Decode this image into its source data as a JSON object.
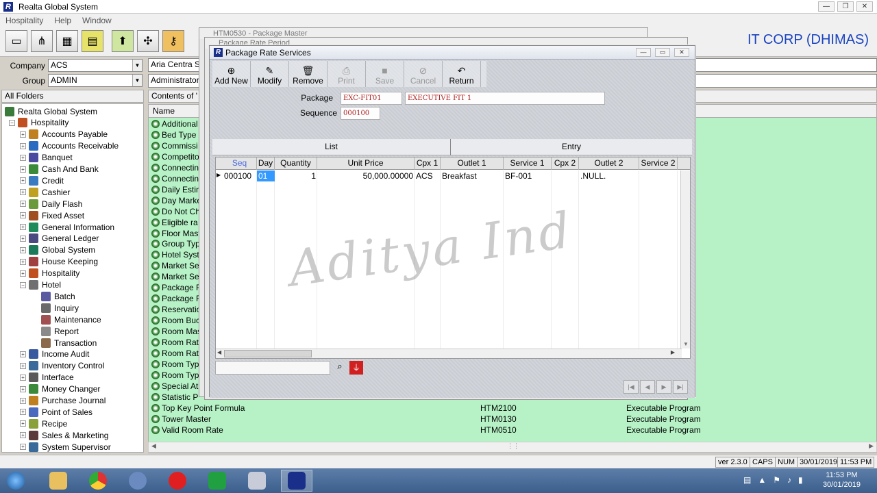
{
  "window": {
    "title": "Realta Global System",
    "logo": "R"
  },
  "menu": [
    "Hospitality",
    "Help",
    "Window"
  ],
  "corp": "IT CORP (DHIMAS)",
  "left": {
    "company_label": "Company",
    "company_value": "ACS",
    "group_label": "Group",
    "group_value": "ADMIN",
    "folders_header": "All Folders",
    "tree": [
      {
        "label": "Realta Global System",
        "level": 0,
        "exp": "",
        "color": "#3a7a3a"
      },
      {
        "label": "Hospitality",
        "level": 1,
        "exp": "−",
        "color": "#c05020"
      },
      {
        "label": "Accounts Payable",
        "level": 2,
        "exp": "+",
        "color": "#c08020"
      },
      {
        "label": "Accounts Receivable",
        "level": 2,
        "exp": "+",
        "color": "#2a6ac0"
      },
      {
        "label": "Banquet",
        "level": 2,
        "exp": "+",
        "color": "#4a4aa0"
      },
      {
        "label": "Cash And Bank",
        "level": 2,
        "exp": "+",
        "color": "#3a8a3a"
      },
      {
        "label": "Credit",
        "level": 2,
        "exp": "+",
        "color": "#3a7ac0"
      },
      {
        "label": "Cashier",
        "level": 2,
        "exp": "+",
        "color": "#c0a020"
      },
      {
        "label": "Daily Flash",
        "level": 2,
        "exp": "+",
        "color": "#6a9a3a"
      },
      {
        "label": "Fixed Asset",
        "level": 2,
        "exp": "+",
        "color": "#a05020"
      },
      {
        "label": "General Information",
        "level": 2,
        "exp": "+",
        "color": "#208a5a"
      },
      {
        "label": "General Ledger",
        "level": 2,
        "exp": "+",
        "color": "#4a4a80"
      },
      {
        "label": "Global System",
        "level": 2,
        "exp": "+",
        "color": "#1a7a5a"
      },
      {
        "label": "House Keeping",
        "level": 2,
        "exp": "+",
        "color": "#a04040"
      },
      {
        "label": "Hospitality",
        "level": 2,
        "exp": "+",
        "color": "#c05020"
      },
      {
        "label": "Hotel",
        "level": 2,
        "exp": "−",
        "color": "#707070"
      },
      {
        "label": "Batch",
        "level": 3,
        "exp": "",
        "color": "#5a5aa0"
      },
      {
        "label": "Inquiry",
        "level": 3,
        "exp": "",
        "color": "#6a6a6a"
      },
      {
        "label": "Maintenance",
        "level": 3,
        "exp": "",
        "color": "#a05050"
      },
      {
        "label": "Report",
        "level": 3,
        "exp": "",
        "color": "#8a8a8a"
      },
      {
        "label": "Transaction",
        "level": 3,
        "exp": "",
        "color": "#8a6a4a"
      },
      {
        "label": "Income Audit",
        "level": 2,
        "exp": "+",
        "color": "#3a5aa0"
      },
      {
        "label": "Inventory Control",
        "level": 2,
        "exp": "+",
        "color": "#3a6a9a"
      },
      {
        "label": "Interface",
        "level": 2,
        "exp": "+",
        "color": "#5a5a5a"
      },
      {
        "label": "Money Changer",
        "level": 2,
        "exp": "+",
        "color": "#3a8a3a"
      },
      {
        "label": "Purchase Journal",
        "level": 2,
        "exp": "+",
        "color": "#c08020"
      },
      {
        "label": "Point of Sales",
        "level": 2,
        "exp": "+",
        "color": "#4a6ac0"
      },
      {
        "label": "Recipe",
        "level": 2,
        "exp": "+",
        "color": "#8aa03a"
      },
      {
        "label": "Sales & Marketing",
        "level": 2,
        "exp": "+",
        "color": "#5a3a3a"
      },
      {
        "label": "System Supervisor",
        "level": 2,
        "exp": "+",
        "color": "#3a6a9a"
      }
    ]
  },
  "content": {
    "path1": "Aria Centra S",
    "path2": "Administrator",
    "contents_header": "Contents of '",
    "col_name": "Name",
    "items": [
      {
        "name": "Additional"
      },
      {
        "name": "Bed Type"
      },
      {
        "name": "Commissi"
      },
      {
        "name": "Competito"
      },
      {
        "name": "Connectin"
      },
      {
        "name": "Connectin"
      },
      {
        "name": "Daily Estin"
      },
      {
        "name": "Day Marke"
      },
      {
        "name": "Do Not Ch"
      },
      {
        "name": "Eligible ra"
      },
      {
        "name": "Floor Mast"
      },
      {
        "name": "Group Typ"
      },
      {
        "name": "Hotel Syst"
      },
      {
        "name": "Market Se"
      },
      {
        "name": "Market Se"
      },
      {
        "name": "Package F"
      },
      {
        "name": "Package F"
      },
      {
        "name": "Reservatio"
      },
      {
        "name": "Room Buc"
      },
      {
        "name": "Room Mas"
      },
      {
        "name": "Room Rat"
      },
      {
        "name": "Room Rat"
      },
      {
        "name": "Room Typ"
      },
      {
        "name": "Room Typ"
      },
      {
        "name": "Special At"
      },
      {
        "name": "Statistic P"
      }
    ],
    "full_items": [
      {
        "name": "Top Key Point Formula",
        "code": "HTM2100",
        "type": "Executable Program"
      },
      {
        "name": "Tower Master",
        "code": "HTM0130",
        "type": "Executable Program"
      },
      {
        "name": "Valid Room Rate",
        "code": "HTM0510",
        "type": "Executable Program"
      }
    ]
  },
  "bg_windows": {
    "w1": "HTM0530 - Package Master",
    "w2": "Package Rate Period"
  },
  "dialog": {
    "title": "Package Rate Services",
    "toolbar": [
      {
        "label": "Add New",
        "icon": "add-icon",
        "glyph": "⊕",
        "enabled": true
      },
      {
        "label": "Modify",
        "icon": "modify-icon",
        "glyph": "✎",
        "enabled": true
      },
      {
        "label": "Remove",
        "icon": "trash-icon",
        "glyph": "🗑",
        "enabled": true
      },
      {
        "label": "Print",
        "icon": "printer-icon",
        "glyph": "⎙",
        "enabled": false
      },
      {
        "label": "Save",
        "icon": "save-icon",
        "glyph": "■",
        "enabled": false
      },
      {
        "label": "Cancel",
        "icon": "cancel-icon",
        "glyph": "⊘",
        "enabled": false
      },
      {
        "label": "Return",
        "icon": "return-icon",
        "glyph": "↶",
        "enabled": true
      }
    ],
    "package_label": "Package",
    "package_code": "EXC-FIT01",
    "package_name": "EXECUTIVE FIT 1",
    "sequence_label": "Sequence",
    "sequence_value": "000100",
    "tab_list": "List",
    "tab_entry": "Entry",
    "columns": [
      "Seq",
      "Day",
      "Quantity",
      "Unit Price",
      "Cpx 1",
      "Outlet 1",
      "Service 1",
      "Cpx 2",
      "Outlet 2",
      "Service 2"
    ],
    "rows": [
      {
        "Seq": "000100",
        "Day": "01",
        "Quantity": "1",
        "Unit Price": "50,000.00000",
        "Cpx 1": "ACS",
        "Outlet 1": "Breakfast",
        "Service 1": "BF-001",
        "Cpx 2": "",
        "Outlet 2": ".NULL.",
        "Service 2": ""
      }
    ]
  },
  "watermark": "Aditya Ind",
  "status": {
    "version": "ver 2.3.0",
    "caps": "CAPS",
    "num": "NUM",
    "date": "30/01/2019",
    "time": "11:53 PM"
  },
  "taskbar": {
    "time": "11:53 PM",
    "date": "30/01/2019"
  },
  "colors": {
    "accent": "#1a44c0",
    "list_bg": "#b6f2c6",
    "field_text": "#b02020"
  }
}
